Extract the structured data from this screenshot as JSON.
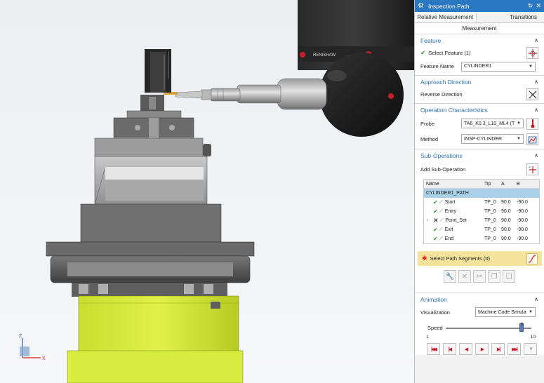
{
  "panel": {
    "title": "Inspection Path",
    "tabs": [
      {
        "label": "Relative Measurement"
      },
      {
        "label": "Transitions"
      }
    ],
    "subtitle": "Measurement"
  },
  "feature": {
    "heading": "Feature",
    "select_label": "Select Feature (1)",
    "name_label": "Feature Name",
    "name_value": "CYLINDER1"
  },
  "approach": {
    "heading": "Approach Direction",
    "reverse_label": "Reverse Direction"
  },
  "operation": {
    "heading": "Operation Characteristics",
    "probe_label": "Probe",
    "probe_value": "TA6_K0.3_L10_ML4 (T",
    "method_label": "Method",
    "method_value": "INSP-CYLINDER"
  },
  "subops": {
    "heading": "Sub-Operations",
    "add_label": "Add Sub-Operation",
    "columns": [
      "Name",
      "Tip",
      "A",
      "B"
    ],
    "parent": "CYLINDER1_PATH",
    "rows": [
      {
        "name": "Start",
        "tip": "TP_0",
        "a": "90.0",
        "b": "-90.0",
        "status": "ok"
      },
      {
        "name": "Entry",
        "tip": "TP_0",
        "a": "90.0",
        "b": "-90.0",
        "status": "ok"
      },
      {
        "name": "Point_Set",
        "tip": "TP_0",
        "a": "90.0",
        "b": "-90.0",
        "status": "error"
      },
      {
        "name": "Exit",
        "tip": "TP_0",
        "a": "90.0",
        "b": "-90.0",
        "status": "ok"
      },
      {
        "name": "End",
        "tip": "TP_0",
        "a": "90.0",
        "b": "-90.0",
        "status": "ok"
      }
    ],
    "path_segments_label": "Select Path Segments (0)"
  },
  "animation": {
    "heading": "Animation",
    "visualization_label": "Visualization",
    "visualization_value": "Machine Code Simula",
    "speed_label": "Speed",
    "speed_value": 9,
    "speed_value_text": "9",
    "speed_min": "1",
    "speed_max": "10"
  },
  "viewport": {
    "brand_text": "RENISHAW",
    "axis_z": "Z",
    "axis_x": "X"
  },
  "colors": {
    "title_bar": "#2b78c2",
    "section_heading": "#2a6fb5",
    "selected_row": "#a9d0e6",
    "highlight_row": "#f6e39b",
    "fixture_green": "#d4ea3c"
  }
}
